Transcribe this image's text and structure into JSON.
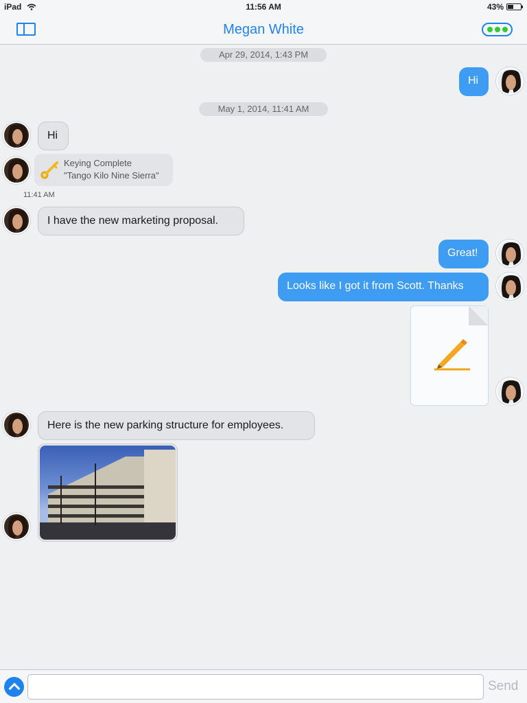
{
  "status_bar": {
    "device": "iPad",
    "time": "11:56 AM",
    "battery": "43%",
    "battery_level": 0.43
  },
  "nav": {
    "title": "Megan White",
    "sidebar_icon": "sidebar-toggle-icon",
    "more_icon": "more-options-icon"
  },
  "dates": {
    "first": "Apr 29, 2014, 1:43 PM",
    "second": "May 1, 2014, 11:41 AM"
  },
  "messages": {
    "out_hi": "Hi",
    "in_hi": "Hi",
    "keying_title": "Keying Complete",
    "keying_phrase": "\"Tango Kilo Nine Sierra\"",
    "keying_time": "11:41 AM",
    "in_marketing": "I have the new marketing proposal.",
    "out_great": "Great!",
    "out_scott": "Looks like I got it from Scott. Thanks",
    "attachment_icon": "pen-document-icon",
    "in_parking": "Here is the new parking structure for employees.",
    "photo_icon": "parking-structure-photo"
  },
  "composer": {
    "value": "",
    "placeholder": "",
    "send_label": "Send"
  },
  "colors": {
    "accent": "#1e83ee",
    "outgoing_bubble": "#3e9cf2",
    "incoming_bubble": "#e3e4e8",
    "status_dots": "#35c93a"
  }
}
